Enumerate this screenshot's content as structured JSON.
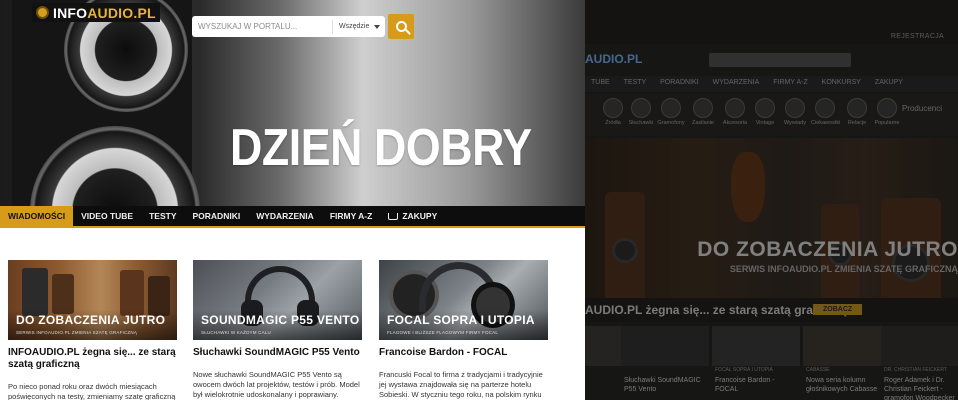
{
  "old_site": {
    "top_link": "REJESTRACJA",
    "logo_text": "AUDIO.PL",
    "nav_items": [
      "TUBE",
      "TESTY",
      "PORADNIKI",
      "WYDARZENIA",
      "FIRMY A-Z",
      "KONKURSY",
      "ZAKUPY"
    ],
    "categories": [
      "Źródła",
      "Słuchawki",
      "Gramofony",
      "Zasilanie",
      "Akcesoria",
      "Vintage",
      "Wywiady",
      "Ciekawostki",
      "Relacje",
      "Popularne"
    ],
    "producers_label": "Producenci",
    "hero_title": "DO ZOBACZENIA JUTRO",
    "hero_subtitle": "SERWIS INFOAUDIO.PL ZMIENIA SZATĘ GRAFICZNĄ",
    "headline": "AUDIO.PL żegna się... ze starą szatą graficzną",
    "see_button": "ZOBACZ",
    "thumbs": [
      {
        "caption": "",
        "label": ""
      },
      {
        "caption": "",
        "label": "Słuchawki SoundMAGIC P55 Vento"
      },
      {
        "caption": "FOCAL SOPRA I UTOPIA",
        "label": "Francoise Bardon - FOCAL"
      },
      {
        "caption": "CABASSE",
        "label": "Nowa seria kolumn głośnikowych Cabasse"
      },
      {
        "caption": "DR. CHRISTIAN FEICKERT",
        "label": "Roger Adamek i Dr. Christian Feickert - gramofon Woodpecker"
      }
    ]
  },
  "new_site": {
    "logo": {
      "part1": "INFO",
      "part2": "AUDIO.PL"
    },
    "search": {
      "placeholder": "WYSZUKAJ W PORTALU...",
      "scope": "Wszędzie"
    },
    "greeting": "DZIEŃ DOBRY",
    "nav": [
      "WIADOMOŚCI",
      "VIDEO TUBE",
      "TESTY",
      "PORADNIKI",
      "WYDARZENIA",
      "FIRMY A-Z",
      "ZAKUPY"
    ],
    "cards": [
      {
        "tag": "DO ZOBACZENIA JUTRO",
        "caption": "SERWIS INFOAUDIO.PL ZMIENIA SZATĘ GRAFICZNĄ",
        "title": "INFOAUDIO.PL żegna się... ze starą szatą graficzną",
        "text": "Po nieco ponad roku oraz dwóch miesiącach poświęconych na testy, zmieniamy szatę graficzną naszego portalu. Systematycznie dążymy do bycia"
      },
      {
        "tag": "SOUNDMAGIC P55 VENTO",
        "caption": "SŁUCHAWKI W KAŻDYM CALU",
        "title": "Słuchawki SoundMAGIC P55 Vento",
        "text": "Nowe słuchawki SoundMAGIC P55 Vento są owocem dwóch lat projektów, testów i prób. Model był wielokrotnie udoskonalany i poprawiany. Pozwolił to"
      },
      {
        "tag": "FOCAL SOPRA I UTOPIA",
        "caption": "FLAGOWE I BLIŻSZE FLAGOWYM FIRMY FOCAL",
        "title": "Francoise Bardon - FOCAL",
        "text": "Francuski Focal to firma z tradycjami i tradycyjnie jej wystawa znajdowała się na parterze hotelu Sobieski. W styczniu tego roku, na polskim rynku pojawił nowy"
      }
    ]
  }
}
